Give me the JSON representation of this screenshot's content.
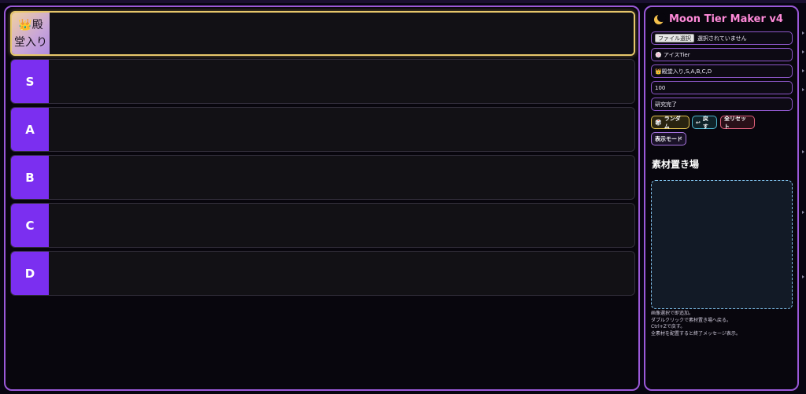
{
  "tiers": [
    {
      "label": "👑殿堂入り",
      "hall_of_fame": true
    },
    {
      "label": "S"
    },
    {
      "label": "A"
    },
    {
      "label": "B"
    },
    {
      "label": "C"
    },
    {
      "label": "D"
    }
  ],
  "sidebar": {
    "title": "Moon Tier Maker v4",
    "file_button": "ファイル選択",
    "file_status": "選択されていません",
    "tier_name": "🍥 アイスTier",
    "tier_labels": "👑殿堂入り,S,A,B,C,D",
    "size_value": "100",
    "status_text": "研究完了",
    "buttons": {
      "random": "ランダム",
      "undo": "戻す",
      "reset": "全リセット",
      "mode": "表示モード"
    },
    "pool_title": "素材置き場",
    "help_lines": [
      "画像選択で即追加。",
      "ダブルクリックで素材置き場へ戻る。",
      "Ctrl+Zで戻す。",
      "全素材を配置すると終了メッセージ表示。"
    ]
  },
  "colors": {
    "accent": "#9b59d9",
    "tier_label": "#7b2ff0",
    "hall_of_fame_border": "#e7c76b",
    "title": "#ff8ad9"
  }
}
